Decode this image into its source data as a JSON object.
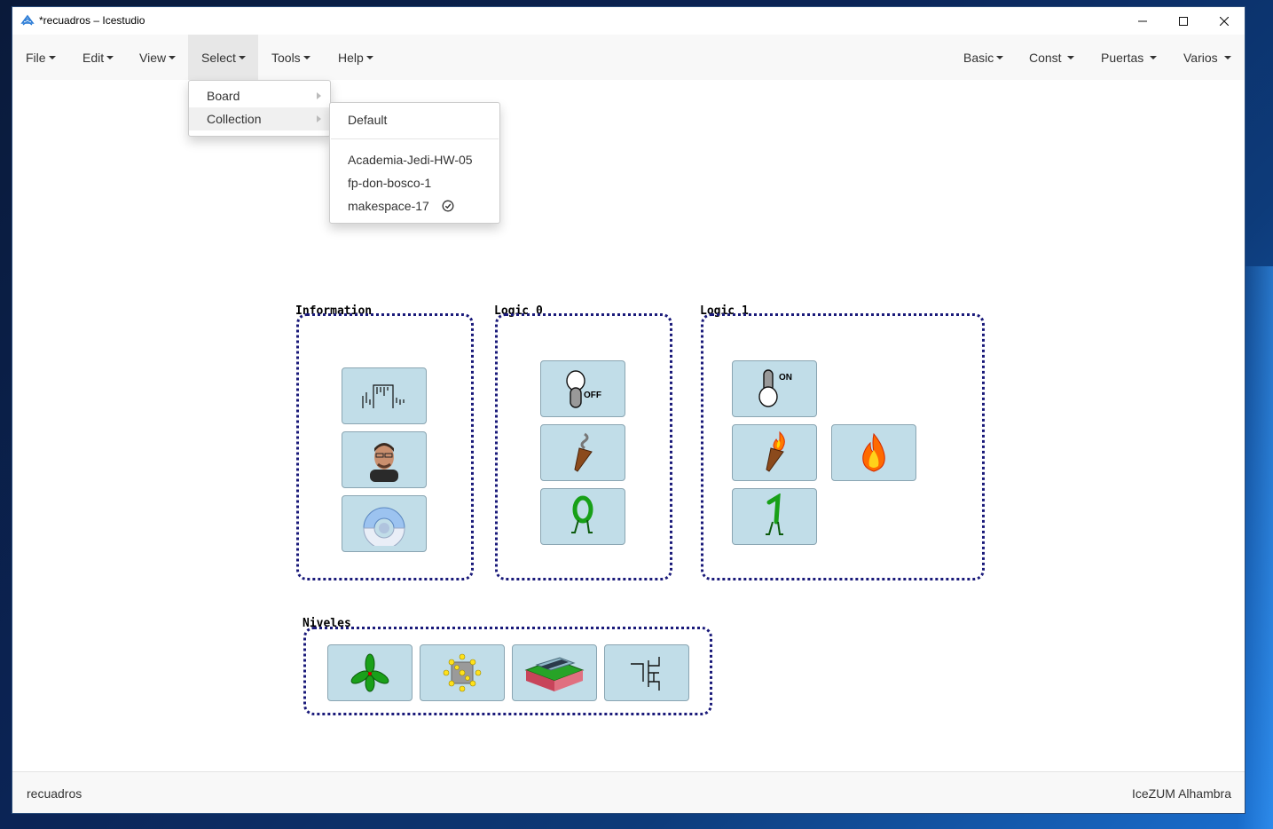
{
  "window": {
    "title": "*recuadros – Icestudio"
  },
  "menubar": {
    "left": [
      {
        "label": "File"
      },
      {
        "label": "Edit"
      },
      {
        "label": "View"
      },
      {
        "label": "Select"
      },
      {
        "label": "Tools"
      },
      {
        "label": "Help"
      }
    ],
    "right": [
      {
        "label": "Basic"
      },
      {
        "label": "Const"
      },
      {
        "label": "Puertas"
      },
      {
        "label": "Varios"
      }
    ]
  },
  "select_menu": {
    "items": [
      {
        "label": "Board"
      },
      {
        "label": "Collection"
      }
    ]
  },
  "collection_submenu": {
    "default_label": "Default",
    "items": [
      {
        "label": "Academia-Jedi-HW-05"
      },
      {
        "label": "fp-don-bosco-1"
      },
      {
        "label": "makespace-17",
        "selected": true
      }
    ]
  },
  "groups": {
    "information": "Information",
    "logic0": "Logic 0",
    "logic1": "Logic 1",
    "niveles": "Niveles"
  },
  "blocks": {
    "logic0_off_text": "OFF",
    "logic1_on_text": "ON"
  },
  "statusbar": {
    "left": "recuadros",
    "right": "IceZUM Alhambra"
  },
  "colors": {
    "block_fill": "#c1dde8",
    "group_border": "#1a1a7a",
    "menu_active": "#e7e7e7"
  }
}
